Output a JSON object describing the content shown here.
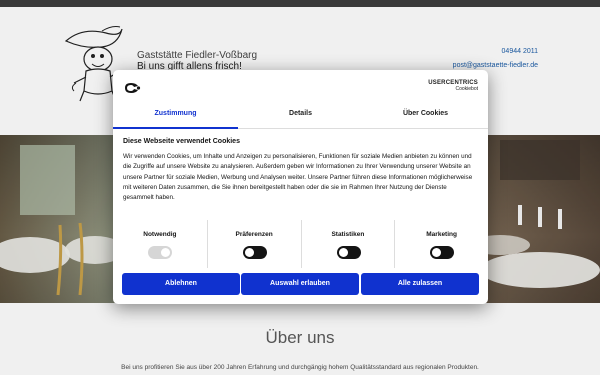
{
  "header": {
    "site_name": "Gaststätte Fiedler-Voßbarg",
    "tagline": "Bi uns gifft allens frisch!",
    "phone": "04944 2011",
    "email": "post@gaststaette-fiedler.de"
  },
  "cookie_dialog": {
    "brand": "USERCENTRICS",
    "brand_sub": "Cookiebot",
    "tabs": [
      "Zustimmung",
      "Details",
      "Über Cookies"
    ],
    "active_tab": "Zustimmung",
    "title": "Diese Webseite verwendet Cookies",
    "body": "Wir verwenden Cookies, um Inhalte und Anzeigen zu personalisieren, Funktionen für soziale Medien anbieten zu können und die Zugriffe auf unsere Website zu analysieren. Außerdem geben wir Informationen zu Ihrer Verwendung unserer Website an unsere Partner für soziale Medien, Werbung und Analysen weiter. Unsere Partner führen diese Informationen möglicherweise mit weiteren Daten zusammen, die Sie ihnen bereitgestellt haben oder die sie im Rahmen Ihrer Nutzung der Dienste gesammelt haben.",
    "toggles": [
      {
        "label": "Notwendig",
        "state": "locked-on"
      },
      {
        "label": "Präferenzen",
        "state": "off"
      },
      {
        "label": "Statistiken",
        "state": "off"
      },
      {
        "label": "Marketing",
        "state": "off"
      }
    ],
    "buttons": {
      "decline": "Ablehnen",
      "allow_selection": "Auswahl erlauben",
      "allow_all": "Alle zulassen"
    },
    "accent_color": "#1032cf"
  },
  "about": {
    "title": "Über uns",
    "text": "Bei uns profitieren Sie aus über 200 Jahren Erfahrung und durchgängig hohem Qualitätsstandard aus regionalen Produkten."
  }
}
